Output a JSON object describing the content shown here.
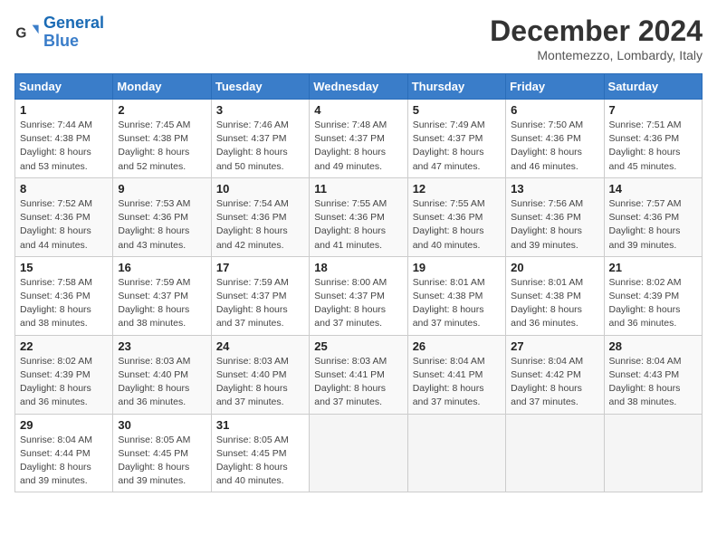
{
  "logo": {
    "text_general": "General",
    "text_blue": "Blue"
  },
  "title": "December 2024",
  "location": "Montemezzo, Lombardy, Italy",
  "weekdays": [
    "Sunday",
    "Monday",
    "Tuesday",
    "Wednesday",
    "Thursday",
    "Friday",
    "Saturday"
  ],
  "weeks": [
    [
      {
        "day": "1",
        "sunrise": "7:44 AM",
        "sunset": "4:38 PM",
        "daylight": "8 hours and 53 minutes."
      },
      {
        "day": "2",
        "sunrise": "7:45 AM",
        "sunset": "4:38 PM",
        "daylight": "8 hours and 52 minutes."
      },
      {
        "day": "3",
        "sunrise": "7:46 AM",
        "sunset": "4:37 PM",
        "daylight": "8 hours and 50 minutes."
      },
      {
        "day": "4",
        "sunrise": "7:48 AM",
        "sunset": "4:37 PM",
        "daylight": "8 hours and 49 minutes."
      },
      {
        "day": "5",
        "sunrise": "7:49 AM",
        "sunset": "4:37 PM",
        "daylight": "8 hours and 47 minutes."
      },
      {
        "day": "6",
        "sunrise": "7:50 AM",
        "sunset": "4:36 PM",
        "daylight": "8 hours and 46 minutes."
      },
      {
        "day": "7",
        "sunrise": "7:51 AM",
        "sunset": "4:36 PM",
        "daylight": "8 hours and 45 minutes."
      }
    ],
    [
      {
        "day": "8",
        "sunrise": "7:52 AM",
        "sunset": "4:36 PM",
        "daylight": "8 hours and 44 minutes."
      },
      {
        "day": "9",
        "sunrise": "7:53 AM",
        "sunset": "4:36 PM",
        "daylight": "8 hours and 43 minutes."
      },
      {
        "day": "10",
        "sunrise": "7:54 AM",
        "sunset": "4:36 PM",
        "daylight": "8 hours and 42 minutes."
      },
      {
        "day": "11",
        "sunrise": "7:55 AM",
        "sunset": "4:36 PM",
        "daylight": "8 hours and 41 minutes."
      },
      {
        "day": "12",
        "sunrise": "7:55 AM",
        "sunset": "4:36 PM",
        "daylight": "8 hours and 40 minutes."
      },
      {
        "day": "13",
        "sunrise": "7:56 AM",
        "sunset": "4:36 PM",
        "daylight": "8 hours and 39 minutes."
      },
      {
        "day": "14",
        "sunrise": "7:57 AM",
        "sunset": "4:36 PM",
        "daylight": "8 hours and 39 minutes."
      }
    ],
    [
      {
        "day": "15",
        "sunrise": "7:58 AM",
        "sunset": "4:36 PM",
        "daylight": "8 hours and 38 minutes."
      },
      {
        "day": "16",
        "sunrise": "7:59 AM",
        "sunset": "4:37 PM",
        "daylight": "8 hours and 38 minutes."
      },
      {
        "day": "17",
        "sunrise": "7:59 AM",
        "sunset": "4:37 PM",
        "daylight": "8 hours and 37 minutes."
      },
      {
        "day": "18",
        "sunrise": "8:00 AM",
        "sunset": "4:37 PM",
        "daylight": "8 hours and 37 minutes."
      },
      {
        "day": "19",
        "sunrise": "8:01 AM",
        "sunset": "4:38 PM",
        "daylight": "8 hours and 37 minutes."
      },
      {
        "day": "20",
        "sunrise": "8:01 AM",
        "sunset": "4:38 PM",
        "daylight": "8 hours and 36 minutes."
      },
      {
        "day": "21",
        "sunrise": "8:02 AM",
        "sunset": "4:39 PM",
        "daylight": "8 hours and 36 minutes."
      }
    ],
    [
      {
        "day": "22",
        "sunrise": "8:02 AM",
        "sunset": "4:39 PM",
        "daylight": "8 hours and 36 minutes."
      },
      {
        "day": "23",
        "sunrise": "8:03 AM",
        "sunset": "4:40 PM",
        "daylight": "8 hours and 36 minutes."
      },
      {
        "day": "24",
        "sunrise": "8:03 AM",
        "sunset": "4:40 PM",
        "daylight": "8 hours and 37 minutes."
      },
      {
        "day": "25",
        "sunrise": "8:03 AM",
        "sunset": "4:41 PM",
        "daylight": "8 hours and 37 minutes."
      },
      {
        "day": "26",
        "sunrise": "8:04 AM",
        "sunset": "4:41 PM",
        "daylight": "8 hours and 37 minutes."
      },
      {
        "day": "27",
        "sunrise": "8:04 AM",
        "sunset": "4:42 PM",
        "daylight": "8 hours and 37 minutes."
      },
      {
        "day": "28",
        "sunrise": "8:04 AM",
        "sunset": "4:43 PM",
        "daylight": "8 hours and 38 minutes."
      }
    ],
    [
      {
        "day": "29",
        "sunrise": "8:04 AM",
        "sunset": "4:44 PM",
        "daylight": "8 hours and 39 minutes."
      },
      {
        "day": "30",
        "sunrise": "8:05 AM",
        "sunset": "4:45 PM",
        "daylight": "8 hours and 39 minutes."
      },
      {
        "day": "31",
        "sunrise": "8:05 AM",
        "sunset": "4:45 PM",
        "daylight": "8 hours and 40 minutes."
      },
      null,
      null,
      null,
      null
    ]
  ]
}
